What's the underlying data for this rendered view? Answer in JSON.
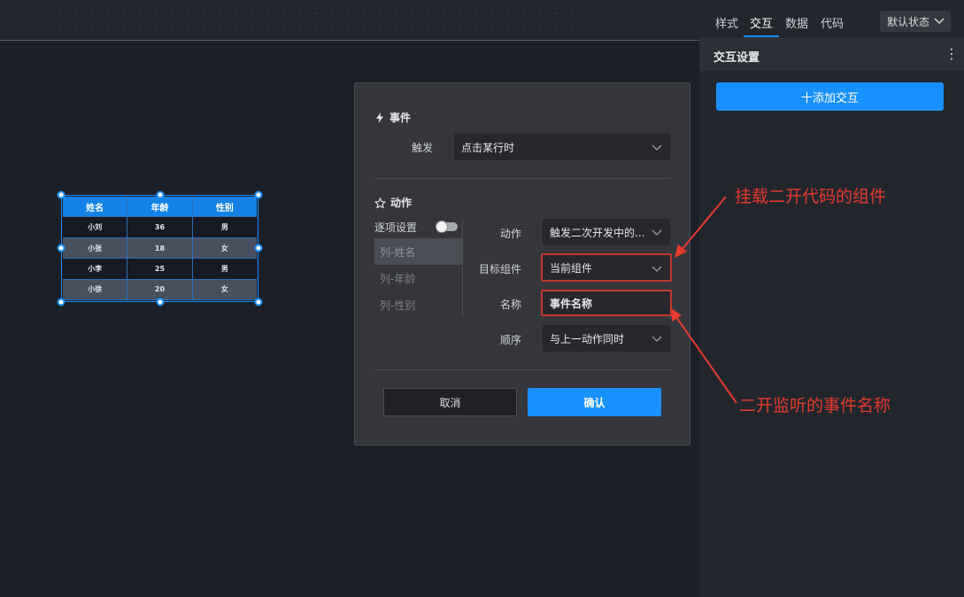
{
  "canvas_table": {
    "headers": [
      "姓名",
      "年龄",
      "性别"
    ],
    "rows": [
      [
        "小刘",
        "36",
        "男"
      ],
      [
        "小张",
        "18",
        "女"
      ],
      [
        "小李",
        "25",
        "男"
      ],
      [
        "小徐",
        "20",
        "女"
      ]
    ]
  },
  "right_panel": {
    "tabs": [
      "样式",
      "交互",
      "数据",
      "代码"
    ],
    "active_tab": "交互",
    "state_select": "默认状态",
    "section_title": "交互设置",
    "add_button": "十添加交互"
  },
  "dialog": {
    "event_section": "事件",
    "trigger_label": "触发",
    "trigger_value": "点击某行时",
    "action_section": "动作",
    "per_item_label": "逐项设置",
    "columns": [
      "列-姓名",
      "列-年龄",
      "列-性别"
    ],
    "action_label": "动作",
    "action_value": "触发二次开发中的...",
    "target_label": "目标组件",
    "target_value": "当前组件",
    "name_label": "名称",
    "name_value": "事件名称",
    "order_label": "顺序",
    "order_value": "与上一动作同时",
    "cancel_button": "取消",
    "confirm_button": "确认"
  },
  "annotations": {
    "target_note": "挂载二开代码的组件",
    "name_note": "二开监听的事件名称"
  },
  "colors": {
    "accent": "#1890ff",
    "annotation": "#e53a2e"
  }
}
